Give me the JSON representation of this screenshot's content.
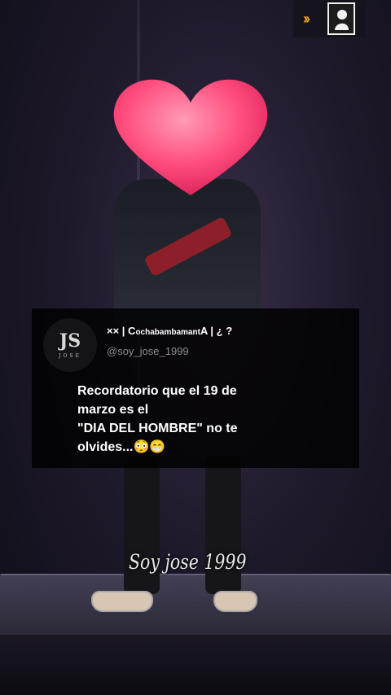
{
  "top_badge": {
    "chevron_icon": "double-chevron-right-icon",
    "avatar_icon": "profile-silhouette-icon"
  },
  "post": {
    "avatar_monogram": "JS",
    "avatar_subtext": "JOSE",
    "display_name": {
      "prefix": "×× | C",
      "suffix": "ochabambamant",
      "end": "A | ¿ ?"
    },
    "username": "@soy_jose_1999",
    "lines": [
      "Recordatorio que el 19 de",
      "marzo es el",
      "\"DIA DEL HOMBRE\" no te",
      "olvides...😳😁"
    ]
  },
  "signature": "Soy jose 1999",
  "colors": {
    "heart": "#ff4d7d",
    "accent": "#f0a030",
    "card_bg": "#000000"
  }
}
